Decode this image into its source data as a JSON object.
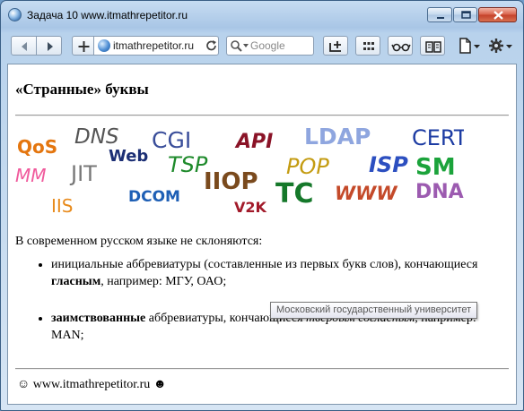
{
  "window": {
    "title": "Задача 10 www.itmathrepetitor.ru"
  },
  "toolbar": {
    "address": "itmathrepetitor.ru",
    "search_placeholder": "Google"
  },
  "page": {
    "heading": "«Странные» буквы",
    "banner_words": [
      "QoS",
      "DNS",
      "CGI",
      "TSP",
      "API",
      "LDAP",
      "CERT",
      "MM",
      "JIT",
      "Web",
      "POP",
      "ISP",
      "SM",
      "IIOP",
      "TC",
      "WWW",
      "DNA",
      "DCOM",
      "IIS",
      "V2K"
    ],
    "intro": "В современном русском языке не склоняются:",
    "item1": {
      "text1": "инициальные аббревиатуры (составленные из первых букв слов), кончающиеся ",
      "bold": "гласным",
      "text2": ", например: МГУ, ОАО;"
    },
    "item2": {
      "bold": "заимствованные",
      "text1": " аббревиатуры, кончающиеся ",
      "italic": "твёрдым согласным",
      "text2": ", например: MAN;"
    },
    "tooltip": "Московский государственный университет",
    "footer": {
      "left_smiley": "☺",
      "site": "www.itmathrepetitor.ru",
      "right_smiley": "☻"
    }
  }
}
